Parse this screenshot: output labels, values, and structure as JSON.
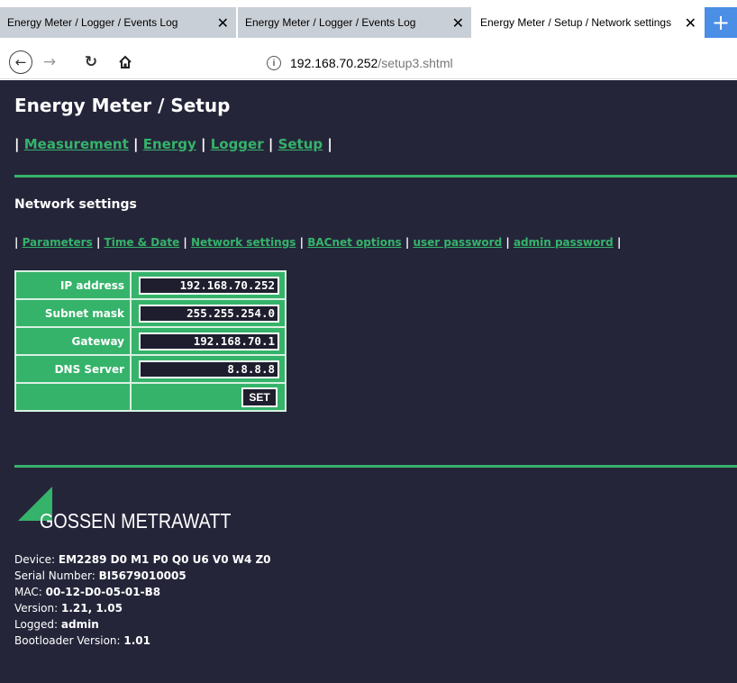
{
  "browser": {
    "tabs": [
      {
        "label": "Energy Meter / Logger / Events Log",
        "active": false
      },
      {
        "label": "Energy Meter / Logger / Events Log",
        "active": false
      },
      {
        "label": "Energy Meter / Setup / Network settings",
        "active": true
      }
    ],
    "close_glyph": "✕",
    "new_tab_glyph": "+",
    "url_host": "192.168.70.252",
    "url_path": "/setup3.shtml",
    "info_glyph": "i"
  },
  "page": {
    "title": "Energy Meter / Setup",
    "menu": [
      "Measurement",
      "Energy",
      "Logger",
      "Setup"
    ],
    "subtitle": "Network settings",
    "submenu": [
      "Parameters",
      "Time & Date",
      "Network settings",
      "BACnet options",
      "user password",
      "admin password"
    ],
    "separator": "|",
    "form": {
      "rows": [
        {
          "label": "IP address",
          "value": "192.168.70.252"
        },
        {
          "label": "Subnet mask",
          "value": "255.255.254.0"
        },
        {
          "label": "Gateway",
          "value": "192.168.70.1"
        },
        {
          "label": "DNS Server",
          "value": "8.8.8.8"
        }
      ],
      "set_label": "SET"
    },
    "logo_text": "GOSSEN METRAWATT",
    "device_info": [
      {
        "key": "Device: ",
        "value": "EM2289 D0 M1 P0 Q0 U6 V0 W4 Z0"
      },
      {
        "key": "Serial Number: ",
        "value": "BI5679010005"
      },
      {
        "key": "MAC: ",
        "value": "00-12-D0-05-01-B8"
      },
      {
        "key": "Version: ",
        "value": "1.21, 1.05"
      },
      {
        "key": "Logged: ",
        "value": "admin"
      },
      {
        "key": "Bootloader Version: ",
        "value": "1.01"
      }
    ]
  },
  "colors": {
    "background": "#25253a",
    "accent": "#35b36a",
    "new_tab": "#4a8ee6"
  }
}
